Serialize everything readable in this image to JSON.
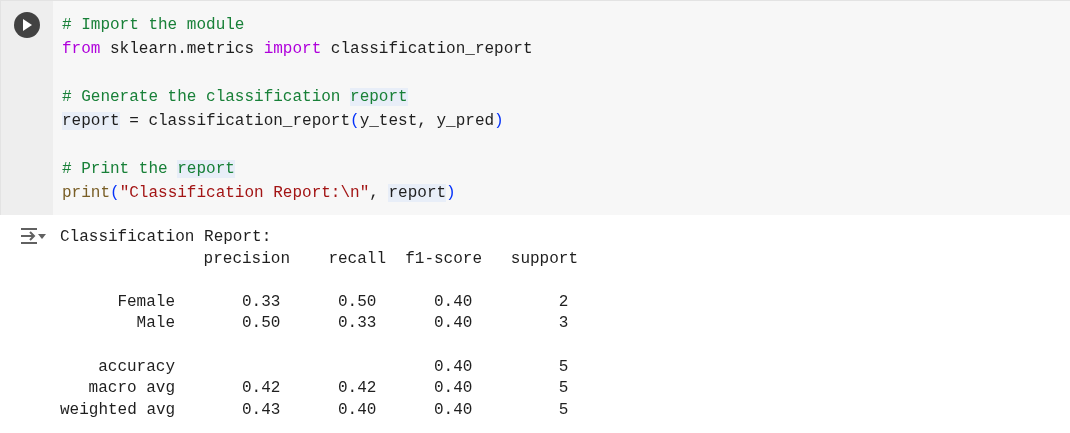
{
  "code_cell": {
    "blocks": [
      [
        [
          {
            "kind": "comment",
            "text": "# Import the module"
          }
        ],
        [
          {
            "kind": "keyword",
            "text": "from"
          },
          {
            "kind": "plain",
            "text": " sklearn.metrics "
          },
          {
            "kind": "keyword",
            "text": "import"
          },
          {
            "kind": "plain",
            "text": " classification_report"
          }
        ]
      ],
      [
        [
          {
            "kind": "comment",
            "text": "# Generate the classification "
          },
          {
            "kind": "comment",
            "text": "report",
            "highlighted": true
          }
        ],
        [
          {
            "kind": "plain",
            "text": "report",
            "highlighted": true
          },
          {
            "kind": "plain",
            "text": " = classification_report"
          },
          {
            "kind": "paren",
            "text": "("
          },
          {
            "kind": "plain",
            "text": "y_test, y_pred"
          },
          {
            "kind": "paren",
            "text": ")"
          }
        ]
      ],
      [
        [
          {
            "kind": "comment",
            "text": "# Print the "
          },
          {
            "kind": "comment",
            "text": "report",
            "highlighted": true
          }
        ],
        [
          {
            "kind": "builtin",
            "text": "print"
          },
          {
            "kind": "paren",
            "text": "("
          },
          {
            "kind": "string",
            "text": "\"Classification Report:\\n\""
          },
          {
            "kind": "plain",
            "text": ", "
          },
          {
            "kind": "plain",
            "text": "report",
            "highlighted": true
          },
          {
            "kind": "paren",
            "text": ")"
          }
        ]
      ]
    ]
  },
  "output": {
    "title": "Classification Report:",
    "columns": [
      "precision",
      "recall",
      "f1-score",
      "support"
    ],
    "row_groups": [
      [
        {
          "label": "Female",
          "precision": "0.33",
          "recall": "0.50",
          "f1_score": "0.40",
          "support": "2"
        },
        {
          "label": "Male",
          "precision": "0.50",
          "recall": "0.33",
          "f1_score": "0.40",
          "support": "3"
        }
      ],
      [
        {
          "label": "accuracy",
          "f1_score": "0.40",
          "support": "5"
        },
        {
          "label": "macro avg",
          "precision": "0.42",
          "recall": "0.42",
          "f1_score": "0.40",
          "support": "5"
        },
        {
          "label": "weighted avg",
          "precision": "0.43",
          "recall": "0.40",
          "f1_score": "0.40",
          "support": "5"
        }
      ]
    ]
  }
}
